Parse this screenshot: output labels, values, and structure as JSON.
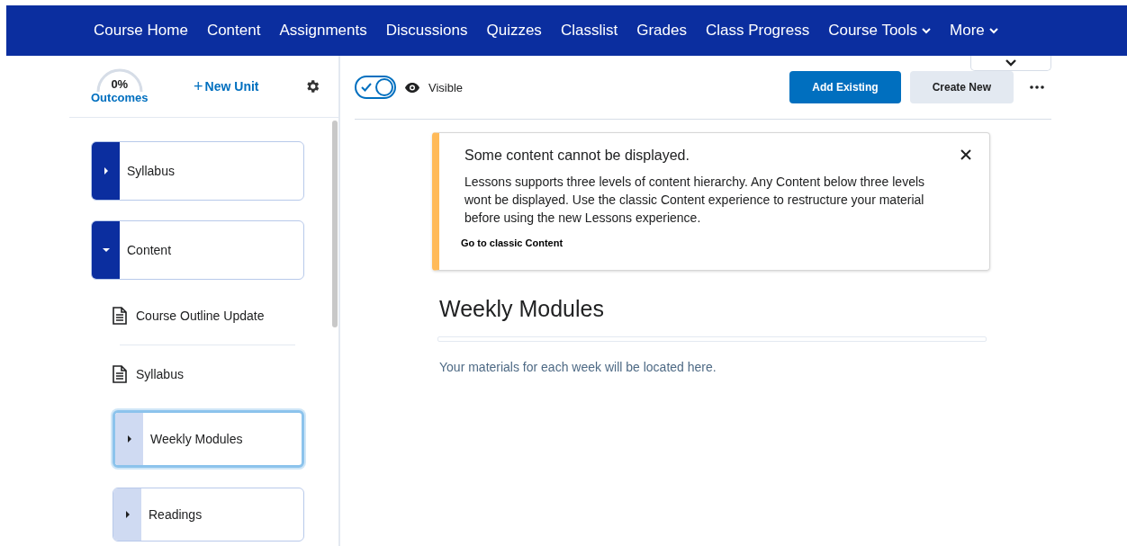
{
  "nav": {
    "items": [
      {
        "label": "Course Home",
        "dropdown": false
      },
      {
        "label": "Content",
        "dropdown": false
      },
      {
        "label": "Assignments",
        "dropdown": false
      },
      {
        "label": "Discussions",
        "dropdown": false
      },
      {
        "label": "Quizzes",
        "dropdown": false
      },
      {
        "label": "Classlist",
        "dropdown": false
      },
      {
        "label": "Grades",
        "dropdown": false
      },
      {
        "label": "Class Progress",
        "dropdown": false
      },
      {
        "label": "Course Tools",
        "dropdown": true
      },
      {
        "label": "More",
        "dropdown": true
      }
    ]
  },
  "sidebar": {
    "outcomes": {
      "percent": "0%",
      "label": "Outcomes"
    },
    "new_unit": {
      "icon": "+",
      "label": "New Unit"
    },
    "tree": [
      {
        "kind": "unit",
        "label": "Syllabus",
        "expanded": false,
        "selected": false
      },
      {
        "kind": "unit",
        "label": "Content",
        "expanded": true,
        "selected": false,
        "children": [
          {
            "kind": "topic",
            "label": "Course Outline Update",
            "selected": false
          },
          {
            "kind": "topic",
            "label": "Syllabus",
            "selected": false
          },
          {
            "kind": "unit",
            "label": "Weekly Modules",
            "expanded": false,
            "selected": true
          },
          {
            "kind": "unit",
            "label": "Readings",
            "expanded": false,
            "selected": false
          }
        ]
      }
    ]
  },
  "toolbar": {
    "visible_toggle": {
      "on": true,
      "label": "Visible"
    },
    "buttons": [
      {
        "label": "Add Existing",
        "kind": "primary"
      },
      {
        "label": "Create New",
        "kind": "secondary"
      }
    ]
  },
  "alert": {
    "title": "Some content cannot be displayed.",
    "body": "Lessons supports three levels of content hierarchy. Any Content below three levels wont be displayed. Use the classic Content experience to restructure your material before using the new Lessons experience.",
    "link": "Go to classic Content"
  },
  "unit": {
    "title": "Weekly Modules",
    "description": "Your materials for each week will be located here."
  }
}
